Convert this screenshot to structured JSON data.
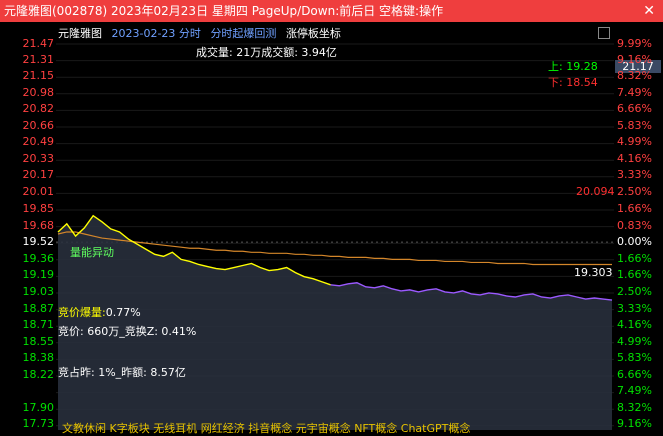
{
  "title": "元隆雅图(002878) 2023年02月23日 星期四 PageUp/Down:前后日 空格键:操作",
  "header": {
    "name": "元隆雅图",
    "date_text": "2023-02-23 分时",
    "mode": "分时起爆回测",
    "coord": "涨停板坐标"
  },
  "volume_text": "成交量: 21万成交额: 3.94亿",
  "price_box": "21.17",
  "up_label": "上: 19.28",
  "down_label": "下: 18.54",
  "left_axis": [
    "21.47",
    "21.31",
    "21.15",
    "20.98",
    "20.82",
    "20.66",
    "20.49",
    "20.33",
    "20.17",
    "20.01",
    "19.85",
    "19.68",
    "19.52",
    "19.36",
    "19.19",
    "19.03",
    "18.87",
    "18.71",
    "18.55",
    "18.38",
    "18.22",
    "17.90",
    "17.73"
  ],
  "right_axis": [
    "9.99%",
    "9.16%",
    "8.32%",
    "7.49%",
    "6.66%",
    "5.83%",
    "4.99%",
    "4.16%",
    "3.33%",
    "2.50%",
    "1.66%",
    "0.83%",
    "0.00%",
    "1.66%",
    "1.66%",
    "2.50%",
    "3.33%",
    "4.16%",
    "4.99%",
    "5.83%",
    "6.66%",
    "7.49%",
    "8.32%",
    "9.16%"
  ],
  "avg_line_label_high": "20.094",
  "avg_line_label_low": "19.303",
  "flag_text": "量能异动",
  "info": {
    "auction_boom_label": "竞价爆量:",
    "auction_boom_value": "0.77%",
    "auction_text": "竞价: 660万_竞换Z: 0.41%",
    "auction_ratio_text": "竞占昨: 1%_昨额: 8.57亿"
  },
  "concepts_text": "文教休闲 K字板块 无线耳机 网红经济 抖音概念 元宇宙概念 NFT概念 ChatGPT概念",
  "colors": {
    "title_bg": "#ef3e3e",
    "avg_line": "#d4862a",
    "price_yellow": "#ffff00",
    "price_purple": "#9b59ff",
    "up_color": "#00ff00",
    "down_color": "#ff3030"
  },
  "chart_data": {
    "type": "line",
    "ylim": [
      17.73,
      21.47
    ],
    "prev_close": 19.52,
    "series": [
      {
        "values": [
          19.62,
          19.7,
          19.58,
          19.66,
          19.78,
          19.72,
          19.65,
          19.62,
          19.55,
          19.5,
          19.45,
          19.4,
          19.38,
          19.42,
          19.35,
          19.33,
          19.3,
          19.28,
          19.26,
          19.25,
          19.27,
          19.29,
          19.31,
          19.27,
          19.24,
          19.25,
          19.27,
          19.22,
          19.18,
          19.16,
          19.13,
          19.1,
          19.09,
          19.11,
          19.12,
          19.08,
          19.07,
          19.09,
          19.06,
          19.04,
          19.05,
          19.03,
          19.05,
          19.06,
          19.03,
          19.02,
          19.04,
          19.01,
          19.0,
          19.02,
          19.01,
          18.99,
          18.98,
          19.0,
          19.01,
          18.98,
          18.97,
          18.99,
          19.0,
          18.98,
          18.96,
          18.97,
          18.96,
          18.95
        ]
      },
      {
        "values": [
          19.6,
          19.62,
          19.62,
          19.6,
          19.58,
          19.56,
          19.55,
          19.54,
          19.53,
          19.52,
          19.51,
          19.5,
          19.49,
          19.48,
          19.47,
          19.46,
          19.46,
          19.45,
          19.44,
          19.44,
          19.43,
          19.43,
          19.42,
          19.42,
          19.41,
          19.41,
          19.41,
          19.4,
          19.4,
          19.39,
          19.39,
          19.38,
          19.38,
          19.37,
          19.37,
          19.37,
          19.36,
          19.36,
          19.35,
          19.35,
          19.35,
          19.34,
          19.34,
          19.34,
          19.33,
          19.33,
          19.33,
          19.32,
          19.32,
          19.32,
          19.31,
          19.31,
          19.31,
          19.31,
          19.3,
          19.3,
          19.3,
          19.3,
          19.3,
          19.3,
          19.3,
          19.3,
          19.3,
          19.3
        ]
      }
    ]
  }
}
